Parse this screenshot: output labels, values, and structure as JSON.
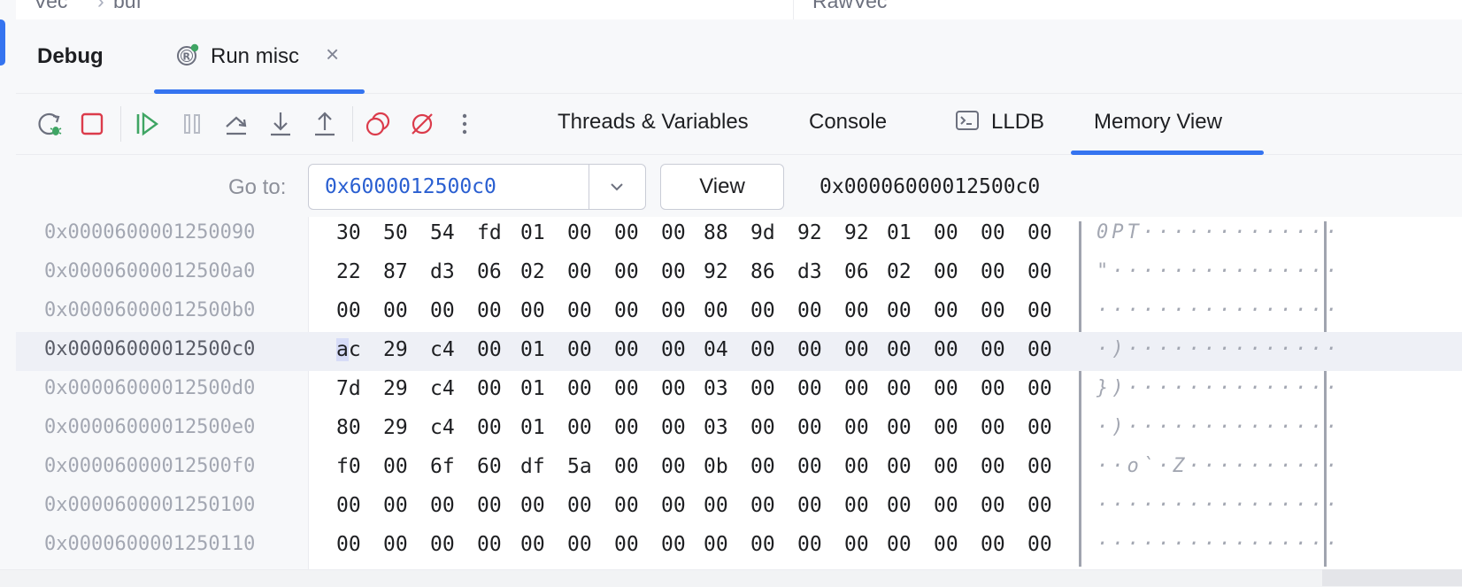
{
  "breadcrumbs": {
    "left": [
      "Vec",
      "buf"
    ],
    "separator": "›",
    "right": "RawVec"
  },
  "tool_window": {
    "title": "Debug",
    "run_tab": {
      "label": "Run misc",
      "close": "×"
    }
  },
  "toolbar": {
    "icons": [
      "rerun-debug-icon",
      "stop-icon",
      "resume-icon",
      "pause-icon",
      "step-over-icon",
      "step-into-icon",
      "step-out-icon",
      "view-breakpoints-icon",
      "mute-breakpoints-icon",
      "more-options-icon"
    ],
    "tabs": [
      {
        "label": "Threads & Variables"
      },
      {
        "label": "Console"
      },
      {
        "label": "LLDB"
      },
      {
        "label": "Memory View",
        "active": true
      }
    ]
  },
  "goto": {
    "label": "Go to:",
    "value": "0x6000012500c0",
    "view_button": "View",
    "current_address": "0x00006000012500c0"
  },
  "memory": {
    "rows": [
      {
        "addr": "0x0000600001250090",
        "bytes": [
          "30",
          "50",
          "54",
          "fd",
          "01",
          "00",
          "00",
          "00",
          "88",
          "9d",
          "92",
          "92",
          "01",
          "00",
          "00",
          "00"
        ],
        "ascii": "0PT·············"
      },
      {
        "addr": "0x00006000012500a0",
        "bytes": [
          "22",
          "87",
          "d3",
          "06",
          "02",
          "00",
          "00",
          "00",
          "92",
          "86",
          "d3",
          "06",
          "02",
          "00",
          "00",
          "00"
        ],
        "ascii": "\"···············"
      },
      {
        "addr": "0x00006000012500b0",
        "bytes": [
          "00",
          "00",
          "00",
          "00",
          "00",
          "00",
          "00",
          "00",
          "00",
          "00",
          "00",
          "00",
          "00",
          "00",
          "00",
          "00"
        ],
        "ascii": "················"
      },
      {
        "addr": "0x00006000012500c0",
        "bytes": [
          "ac",
          "29",
          "c4",
          "00",
          "01",
          "00",
          "00",
          "00",
          "04",
          "00",
          "00",
          "00",
          "00",
          "00",
          "00",
          "00"
        ],
        "ascii": "·)··············",
        "selected": true
      },
      {
        "addr": "0x00006000012500d0",
        "bytes": [
          "7d",
          "29",
          "c4",
          "00",
          "01",
          "00",
          "00",
          "00",
          "03",
          "00",
          "00",
          "00",
          "00",
          "00",
          "00",
          "00"
        ],
        "ascii": "})··············"
      },
      {
        "addr": "0x00006000012500e0",
        "bytes": [
          "80",
          "29",
          "c4",
          "00",
          "01",
          "00",
          "00",
          "00",
          "03",
          "00",
          "00",
          "00",
          "00",
          "00",
          "00",
          "00"
        ],
        "ascii": "·)··············"
      },
      {
        "addr": "0x00006000012500f0",
        "bytes": [
          "f0",
          "00",
          "6f",
          "60",
          "df",
          "5a",
          "00",
          "00",
          "0b",
          "00",
          "00",
          "00",
          "00",
          "00",
          "00",
          "00"
        ],
        "ascii": "··o`·Z··········"
      },
      {
        "addr": "0x0000600001250100",
        "bytes": [
          "00",
          "00",
          "00",
          "00",
          "00",
          "00",
          "00",
          "00",
          "00",
          "00",
          "00",
          "00",
          "00",
          "00",
          "00",
          "00"
        ],
        "ascii": "················"
      },
      {
        "addr": "0x0000600001250110",
        "bytes": [
          "00",
          "00",
          "00",
          "00",
          "00",
          "00",
          "00",
          "00",
          "00",
          "00",
          "00",
          "00",
          "00",
          "00",
          "00",
          "00"
        ],
        "ascii": "················"
      }
    ]
  },
  "colors": {
    "accent": "#3574f0",
    "run_green": "#3fa564",
    "stop_red": "#db3b4b"
  }
}
